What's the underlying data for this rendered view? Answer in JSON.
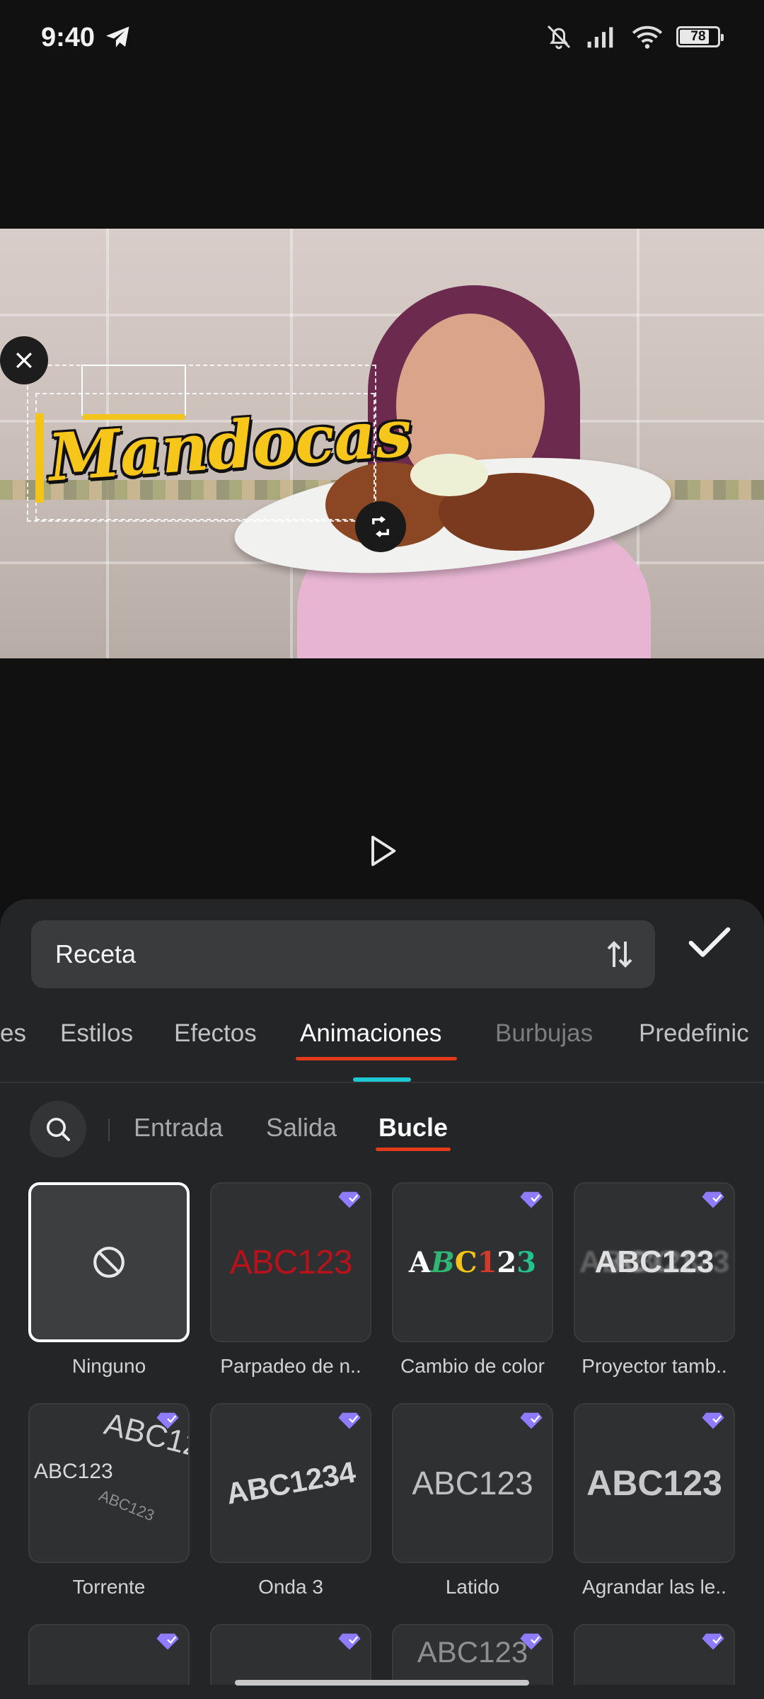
{
  "status_bar": {
    "time": "9:40",
    "battery": "78"
  },
  "editor": {
    "text_value": "Receta",
    "overlay_text": "Mandocas"
  },
  "tabs": [
    "es",
    "Estilos",
    "Efectos",
    "Animaciones",
    "Burbujas",
    "Predefinic"
  ],
  "active_tab": "Animaciones",
  "subtabs": [
    "Entrada",
    "Salida",
    "Bucle"
  ],
  "active_subtab": "Bucle",
  "animations": [
    {
      "label": "Ninguno",
      "preview": "none-icon",
      "premium": false,
      "selected": true
    },
    {
      "label": "Parpadeo de n..",
      "preview": "ABC123",
      "premium": true
    },
    {
      "label": "Cambio de color",
      "preview": "ABC123",
      "premium": true
    },
    {
      "label": "Proyector tamb..",
      "preview": "ABC123",
      "premium": true
    },
    {
      "label": "Torrente",
      "preview": "ABC123",
      "premium": true
    },
    {
      "label": "Onda 3",
      "preview": "ABC1234",
      "premium": true
    },
    {
      "label": "Latido",
      "preview": "ABC123",
      "premium": true
    },
    {
      "label": "Agrandar las le..",
      "preview": "ABC123",
      "premium": true
    },
    {
      "label": "",
      "preview": "",
      "premium": true
    },
    {
      "label": "",
      "preview": "",
      "premium": true
    },
    {
      "label": "",
      "preview": "ABC123",
      "premium": true
    },
    {
      "label": "",
      "preview": "",
      "premium": true
    }
  ],
  "colors": {
    "accent_red": "#e03a1a",
    "accent_cyan": "#1ec9d6",
    "title_yellow": "#f7c61b",
    "gem_purple": "#8f7bff"
  }
}
